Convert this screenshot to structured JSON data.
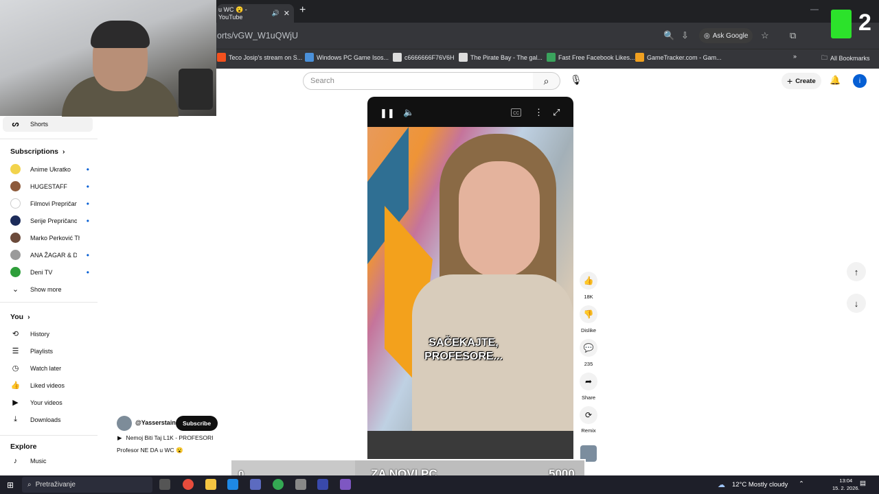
{
  "browser": {
    "tab_title": "u WC 😮 - YouTube",
    "tab_close": "✕",
    "new_tab": "+",
    "url": "orts/vGW_W1uQWjU",
    "ask_google": "Ask Google",
    "bookmarks": [
      {
        "label": "Teco Josip's stream on S...",
        "color": "#f4511e"
      },
      {
        "label": "Windows PC Game Isos...",
        "color": "#4a90d9"
      },
      {
        "label": "c6666666F76V6H",
        "color": "#dddddd"
      },
      {
        "label": "The Pirate Bay - The gal...",
        "color": "#dddddd"
      },
      {
        "label": "Fast Free Facebook Likes...",
        "color": "#3aa35d"
      },
      {
        "label": "GameTracker.com - Gam...",
        "color": "#f0a020"
      }
    ],
    "more_bookmarks": "»",
    "all_bookmarks": "All Bookmarks"
  },
  "overlay_badge": {
    "number": "2"
  },
  "header": {
    "search_placeholder": "Search",
    "create_label": "Create",
    "avatar_letter": "i"
  },
  "sidebar": {
    "shorts_label": "Shorts",
    "subscriptions_title": "Subscriptions",
    "subscriptions": [
      {
        "label": "Anime Ukratko",
        "dot": "•",
        "color": "#f2d34c"
      },
      {
        "label": "HUGESTAFF",
        "dot": "•",
        "color": "#8d5a3b"
      },
      {
        "label": "Filmovi Prepričano",
        "dot": "•",
        "color": "#ffffff"
      },
      {
        "label": "Serije Prepričano",
        "dot": "•",
        "color": "#1c2b5a"
      },
      {
        "label": "Marko Perković Th...",
        "dot": "",
        "color": "#6b4a3a"
      },
      {
        "label": "ANA ŽAGAR & DRV...",
        "dot": "•",
        "color": "#9a9a9a"
      },
      {
        "label": "Deni TV",
        "dot": "•",
        "color": "#2e9e3a"
      }
    ],
    "show_more": "Show more",
    "you_title": "You",
    "you_items": [
      "History",
      "Playlists",
      "Watch later",
      "Liked videos",
      "Your videos",
      "Downloads"
    ],
    "explore_title": "Explore",
    "explore_items": [
      "Music"
    ]
  },
  "video": {
    "caption_line1": "SAČEKAJTE,",
    "caption_line2": "PROFESORE..."
  },
  "actions": {
    "likes": "18K",
    "dislike": "Dislike",
    "comments": "235",
    "share": "Share",
    "remix": "Remix"
  },
  "channel": {
    "handle": "@Yasserstain",
    "subscribe": "Subscribe",
    "title_line1": "Nemoj Biti Taj L1K - PROFESORI",
    "title_line2": "Profesor NE DA u WC 😮"
  },
  "counter": {
    "current": "0",
    "label": "ZA NOVI PC",
    "goal": "5000"
  },
  "taskbar": {
    "search_label": "Pretraživanje",
    "weather": "12°C  Mostly cloudy",
    "time": "13:04",
    "date": "15. 2. 2026."
  }
}
